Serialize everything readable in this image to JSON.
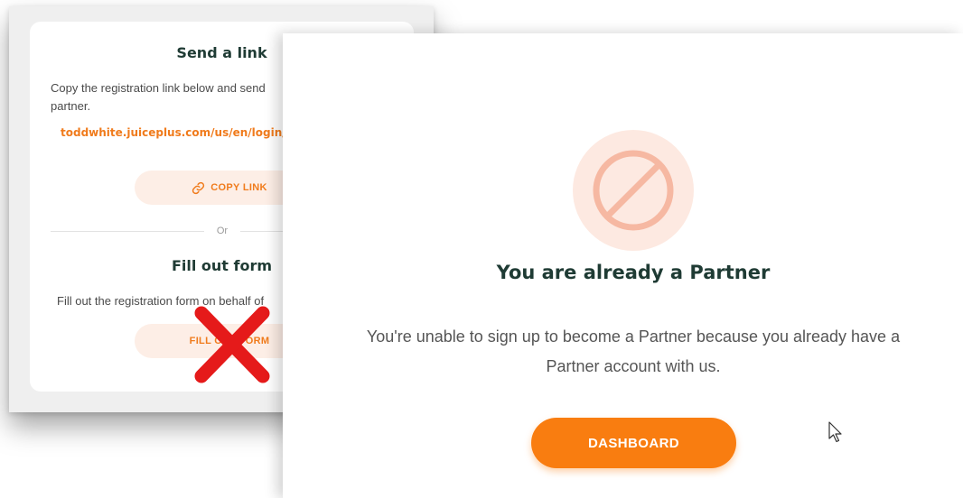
{
  "back_card": {
    "send_heading": "Send a link",
    "send_instructions": "Copy the registration link below and send",
    "send_instructions_2": "partner.",
    "registration_link": "toddwhite.juiceplus.com/us/en/login/",
    "copy_link_label": "COPY LINK",
    "divider_label": "Or",
    "fill_heading": "Fill out form",
    "fill_instructions": "Fill out the registration form on behalf of",
    "fill_form_label": "FILL OUT FORM"
  },
  "front_panel": {
    "title": "You are already a Partner",
    "message": "You're unable to sign up to become a Partner because you already have a Partner account with us.",
    "dashboard_label": "DASHBOARD"
  },
  "colors": {
    "accent": "#f97d10",
    "link": "#f07b1c",
    "heading": "#1f3b34",
    "pill_bg": "#fdeee6",
    "ban_bg": "#fde9e1",
    "ban_stroke": "#f6b8a2",
    "red_x": "#e51a1a"
  },
  "icons": {
    "copy_link": "link-icon",
    "restricted": "ban-icon",
    "annotation": "red-x-mark",
    "cursor": "mouse-pointer-icon"
  }
}
